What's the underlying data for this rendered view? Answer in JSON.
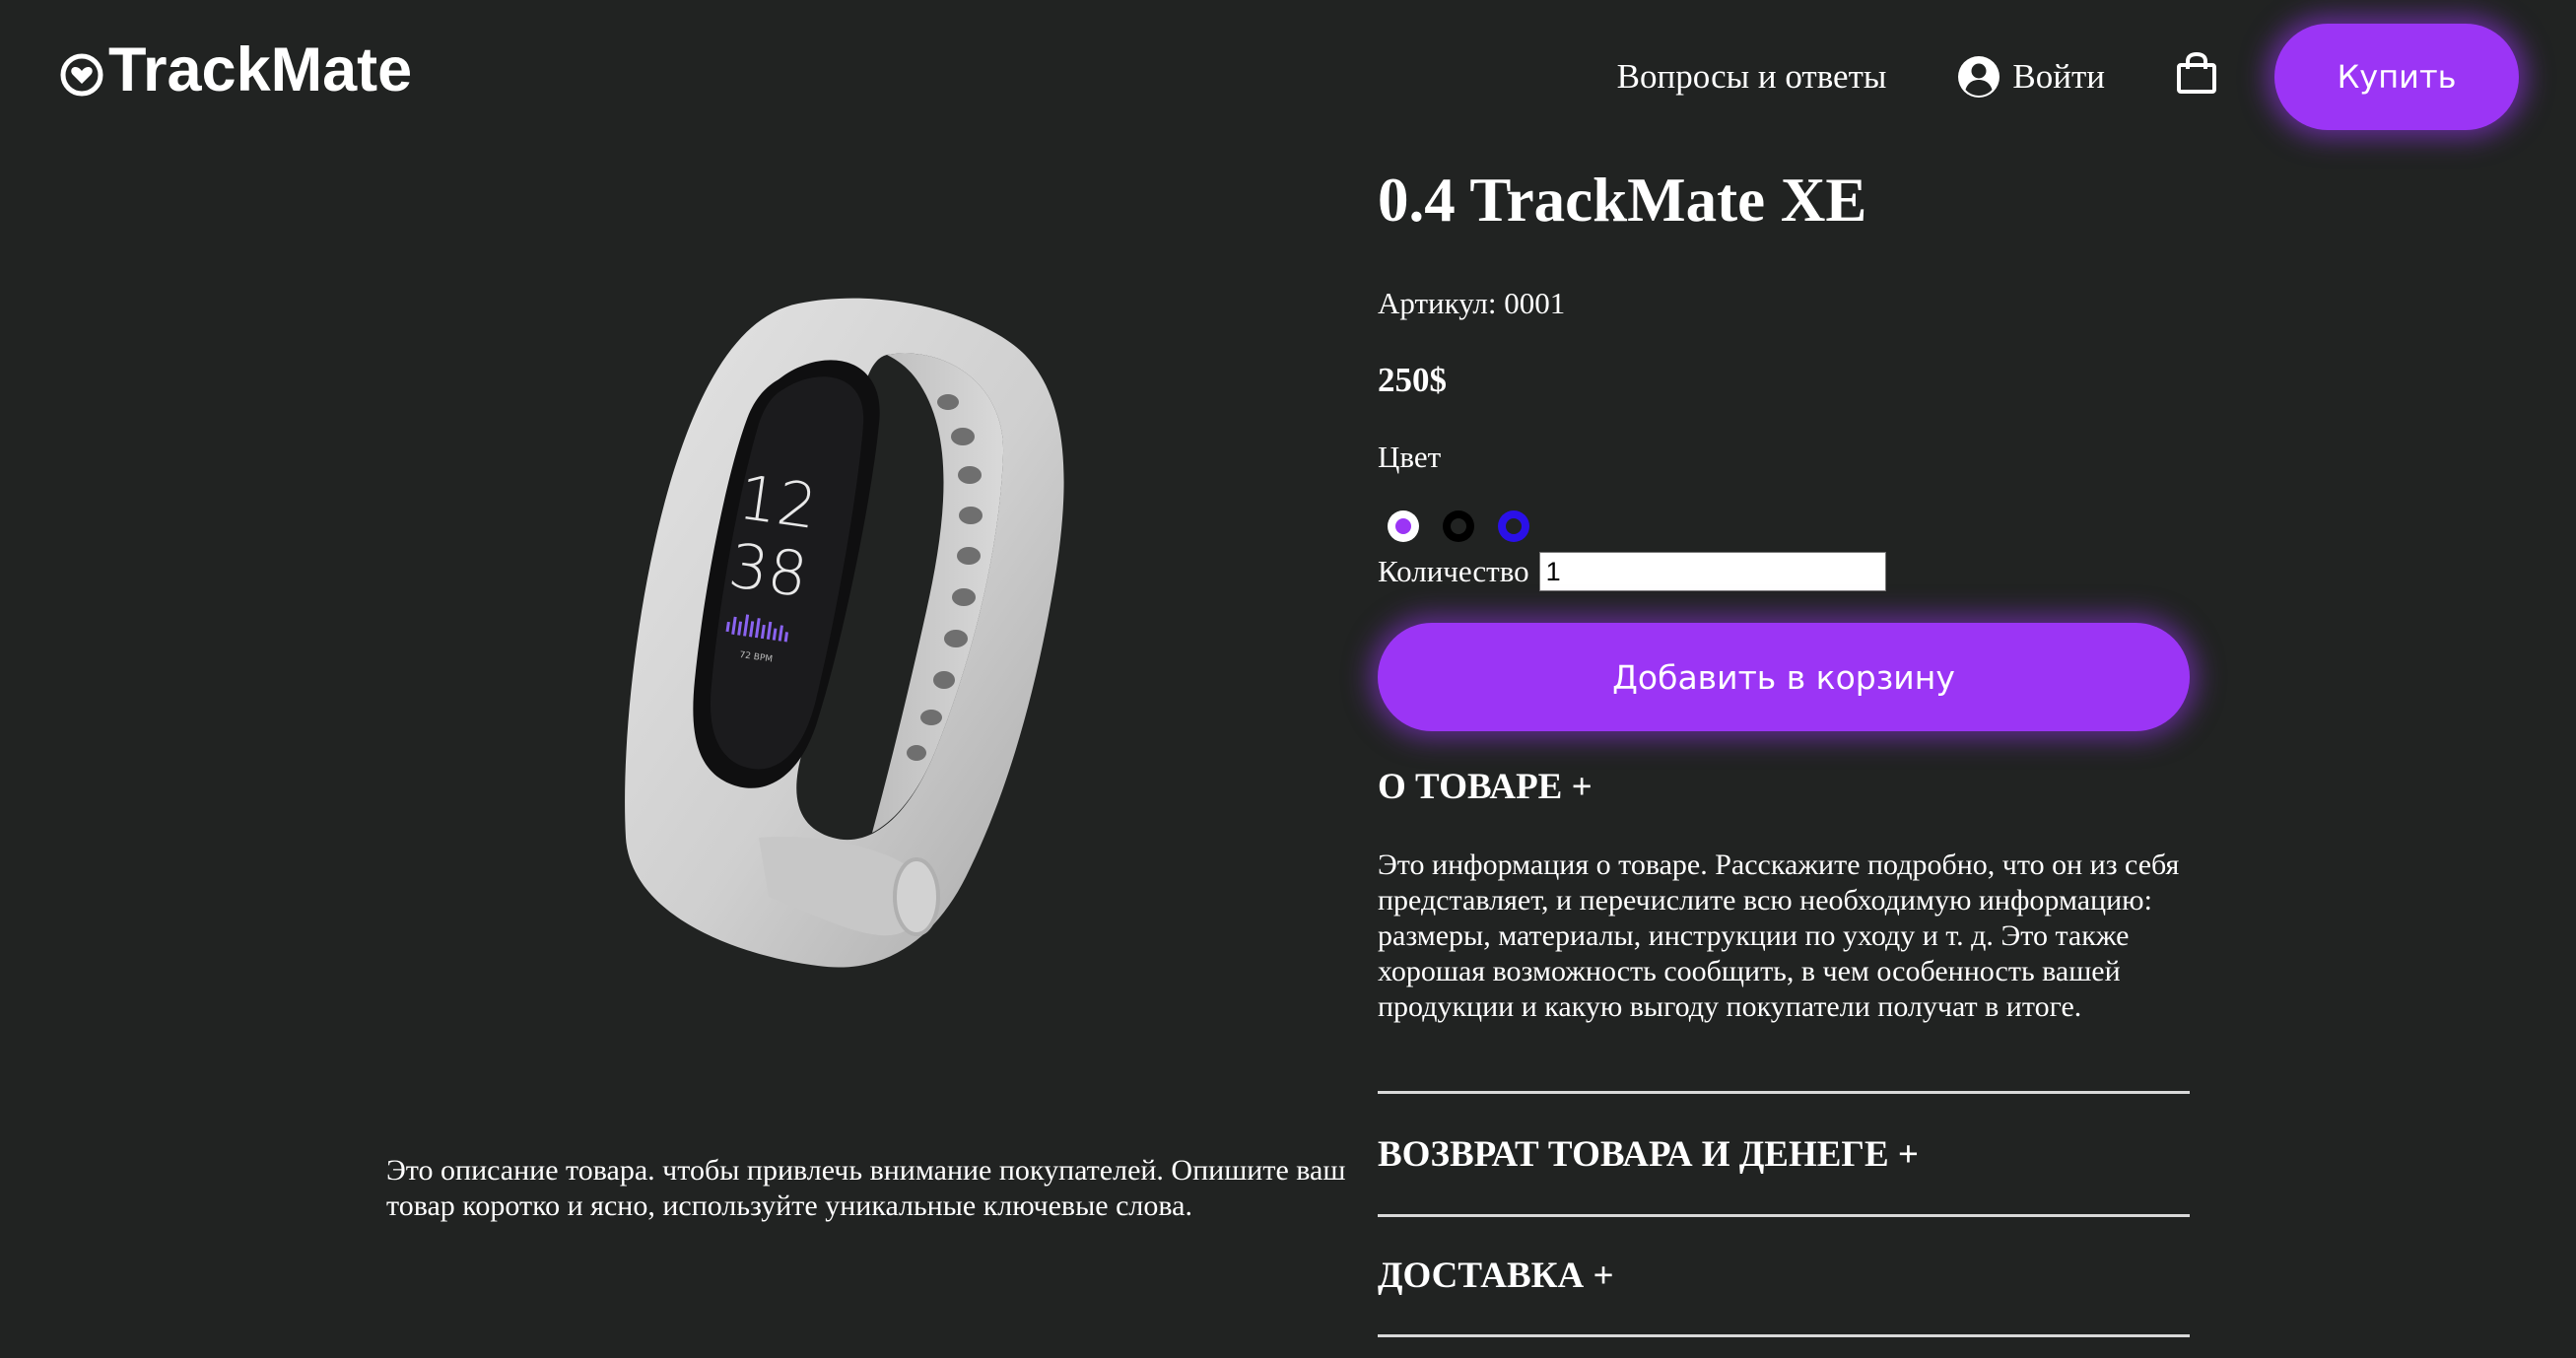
{
  "header": {
    "logo_text": "TrackMate",
    "logo_icon": "heart-circle-icon",
    "nav": {
      "faq": "Вопросы и ответы",
      "login": "Войти",
      "login_icon": "user-circle-icon",
      "cart_icon": "shopping-bag-icon",
      "buy": "Купить"
    }
  },
  "product": {
    "title": "0.4 TrackMate XE",
    "sku": "Артикул: 0001",
    "price": "250$",
    "color_label": "Цвет",
    "colors": [
      {
        "name": "white",
        "ring": "#ffffff",
        "dot": "#9b35f5",
        "selected": true
      },
      {
        "name": "black",
        "ring": "#000000",
        "dot": "#212322",
        "selected": false
      },
      {
        "name": "blue",
        "ring": "#2a10e8",
        "dot": "#212322",
        "selected": false
      }
    ],
    "quantity_label": "Количество",
    "quantity_value": "1",
    "add_to_cart": "Добавить в корзину",
    "image_alt": "fitness-band-image",
    "band_screen": {
      "hour": "12",
      "minute": "38",
      "bpm": "72 BPM"
    },
    "short_description": "Это описание товара. чтобы привлечь внимание покупателей. Опишите ваш товар коротко и ясно, используйте уникальные ключевые слова."
  },
  "accordion": {
    "about_title": "О ТОВАРЕ +",
    "about_text": "Это информация о товаре. Расскажите подробно, что он из себя представляет, и перечислите всю необходимую информацию: размеры, материалы, инструкции по уходу и т. д. Это также хорошая возможность сообщить, в чем особенность вашей продукции и какую выгоду покупатели получат в итоге.",
    "return_title": "ВОЗВРАТ ТОВАРА И ДЕНЕГЕ +",
    "delivery_title": "ДОСТАВКА +"
  },
  "colors": {
    "background": "#212322",
    "accent": "#9b35f5",
    "text": "#ffffff"
  }
}
